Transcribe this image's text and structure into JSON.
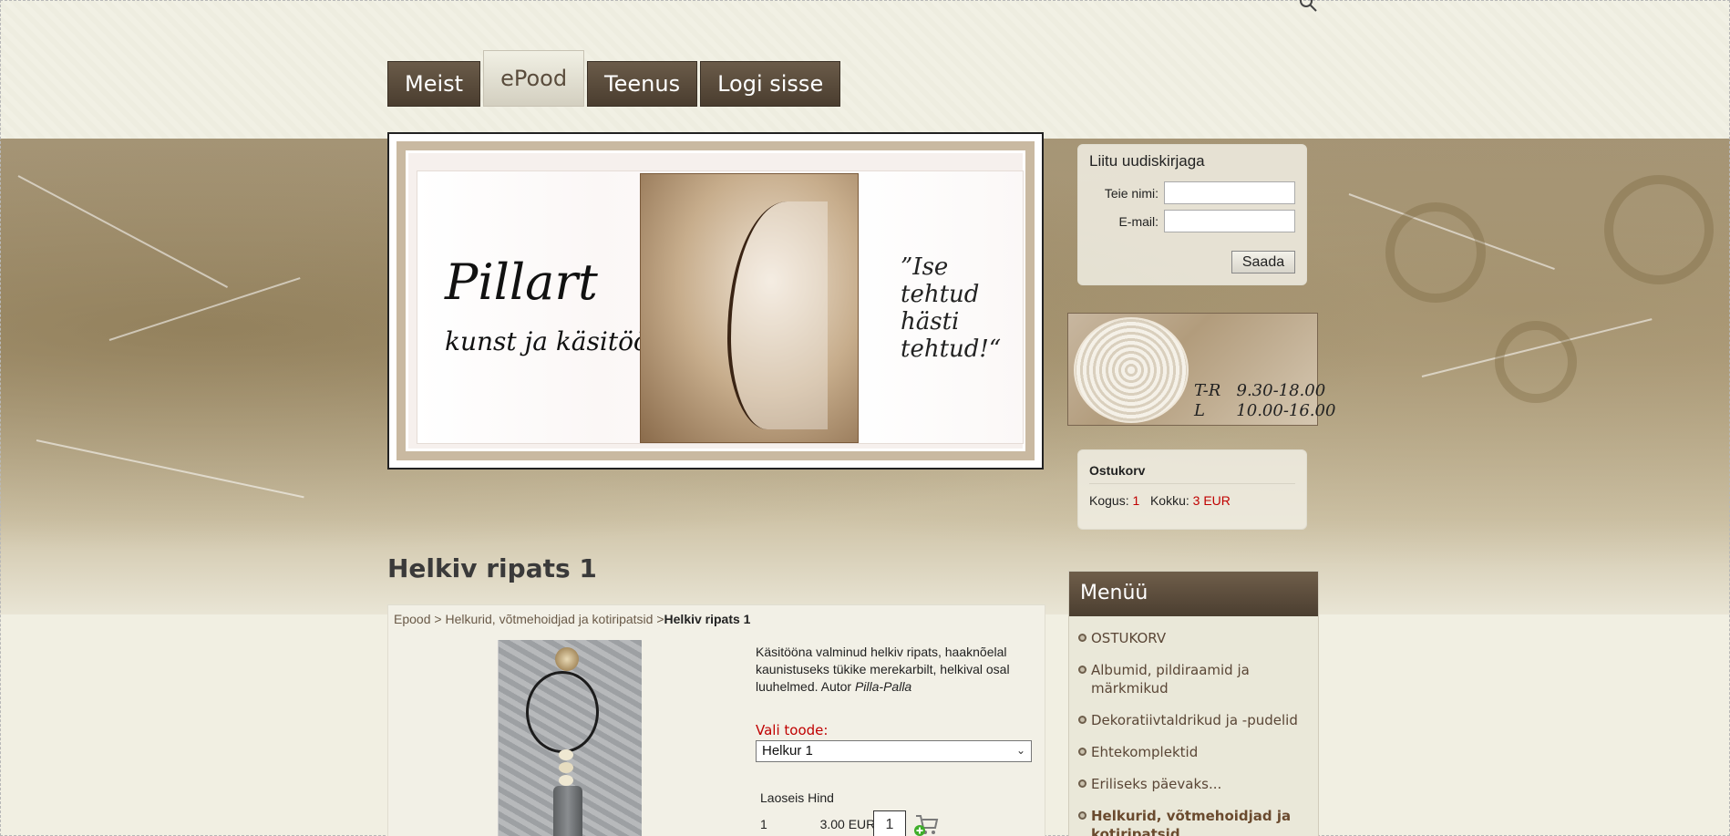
{
  "nav": {
    "tabs": [
      {
        "label": "Meist",
        "active": false
      },
      {
        "label": "ePood",
        "active": true
      },
      {
        "label": "Teenus",
        "active": false
      },
      {
        "label": "Logi sisse",
        "active": false
      }
    ]
  },
  "banner": {
    "title": "Pillart",
    "subtitle": "kunst ja käsitöö",
    "quote_lines": [
      "”Ise",
      "tehtud",
      "hästi",
      "tehtud!“"
    ]
  },
  "newsletter": {
    "title": "Liitu uudiskirjaga",
    "name_label": "Teie nimi:",
    "email_label": "E-mail:",
    "submit_label": "Saada"
  },
  "hours": {
    "line1": "T-R   9.30-18.00",
    "line2": "L      10.00-16.00"
  },
  "cart": {
    "title": "Ostukorv",
    "qty_label": "Kogus:",
    "qty_value": "1",
    "total_label": "Kokku:",
    "total_value": "3 EUR"
  },
  "menu": {
    "title": "Menüü",
    "items": [
      {
        "label": "OSTUKORV",
        "active": false
      },
      {
        "label": "Albumid, pildiraamid ja märkmikud",
        "active": false
      },
      {
        "label": "Dekoratiivtaldrikud ja -pudelid",
        "active": false
      },
      {
        "label": "Ehtekomplektid",
        "active": false
      },
      {
        "label": "Eriliseks päevaks...",
        "active": false
      },
      {
        "label": "Helkurid, võtmehoidjad ja kotiripatsid",
        "active": true
      }
    ]
  },
  "product": {
    "title": "Helkiv ripats 1",
    "breadcrumb": {
      "root": "Epood",
      "sep1": " > ",
      "category": "Helkurid, võtmehoidjad ja kotiripatsid",
      "sep2": " >",
      "current": "Helkiv ripats 1"
    },
    "description": "Käsitööna valminud helkiv ripats, haaknõelal kaunistuseks tükike merekarbilt, helkival osal luuhelmed. Autor ",
    "author": "Pilla-Palla",
    "choose_label": "Vali toode:",
    "selected_option": "Helkur 1",
    "stock_header": "Laoseis Hind",
    "stock_value": "1",
    "price": "3.00 EUR",
    "quantity": "1"
  },
  "colors": {
    "tab_bg": "#4a3d2f",
    "accent_red": "#c00000",
    "menu_link": "#5a4636"
  }
}
